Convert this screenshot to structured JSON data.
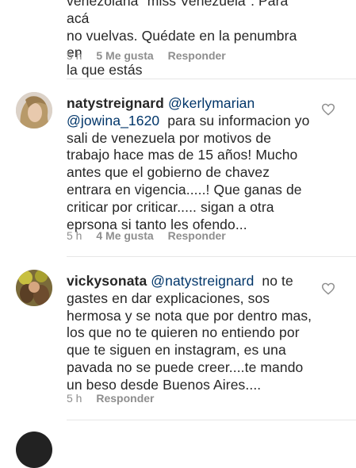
{
  "comment0": {
    "line1": "venezolana \"miss Venezuela\". Para acá",
    "line2": "no vuelvas. Quédate en la penumbra en",
    "line3": "la que estás",
    "time": "5 h",
    "likes": "5 Me gusta",
    "reply": "Responder"
  },
  "comment1": {
    "username": "natystreignard",
    "mention1": "@kerlymarian",
    "mention2": "@jowina_1620",
    "text1": "para su informacion yo",
    "line3": "sali de venezuela por motivos de",
    "line4": "trabajo hace mas de 15 años! Mucho",
    "line5": "antes que el gobierno de chavez",
    "line6": "entrara en vigencia.....! Que ganas de",
    "line7": "criticar por criticar..... sigan a otra",
    "line8": "eprsona si tanto les ofendo...",
    "time": "5 h",
    "likes": "4 Me gusta",
    "reply": "Responder"
  },
  "comment2": {
    "username": "vickysonata",
    "mention": "@natystreignard",
    "text1": "no te",
    "line2": "gastes en dar explicaciones, sos",
    "line3": "hermosa y se nota que por dentro mas,",
    "line4": "los que no te quieren no entiendo por",
    "line5": "que te siguen en instagram, es una",
    "line6": "pavada no se puede creer....te mando",
    "line7": "un beso desde Buenos Aires....",
    "time": "5 h",
    "reply": "Responder"
  },
  "icons": {
    "like": "heart-outline-icon"
  },
  "colors": {
    "text": "#262626",
    "mention": "#003569",
    "meta": "#8e8e8e"
  }
}
